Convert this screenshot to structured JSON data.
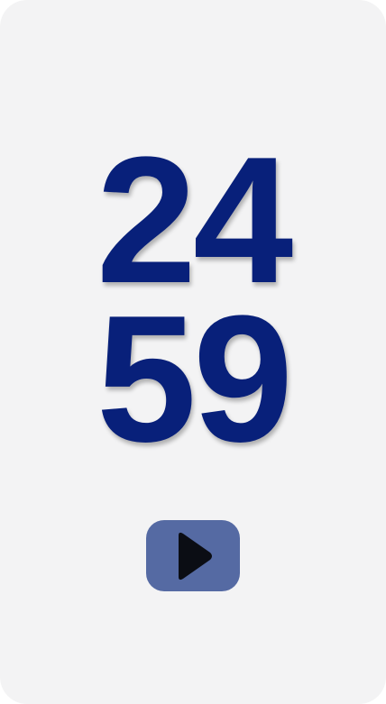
{
  "timer": {
    "minutes": "24",
    "seconds": "59"
  },
  "controls": {
    "play_icon": "play-icon"
  },
  "colors": {
    "background": "#f3f3f4",
    "digits": "#08207a",
    "button": "#556aa3",
    "icon": "#0b0d14"
  }
}
